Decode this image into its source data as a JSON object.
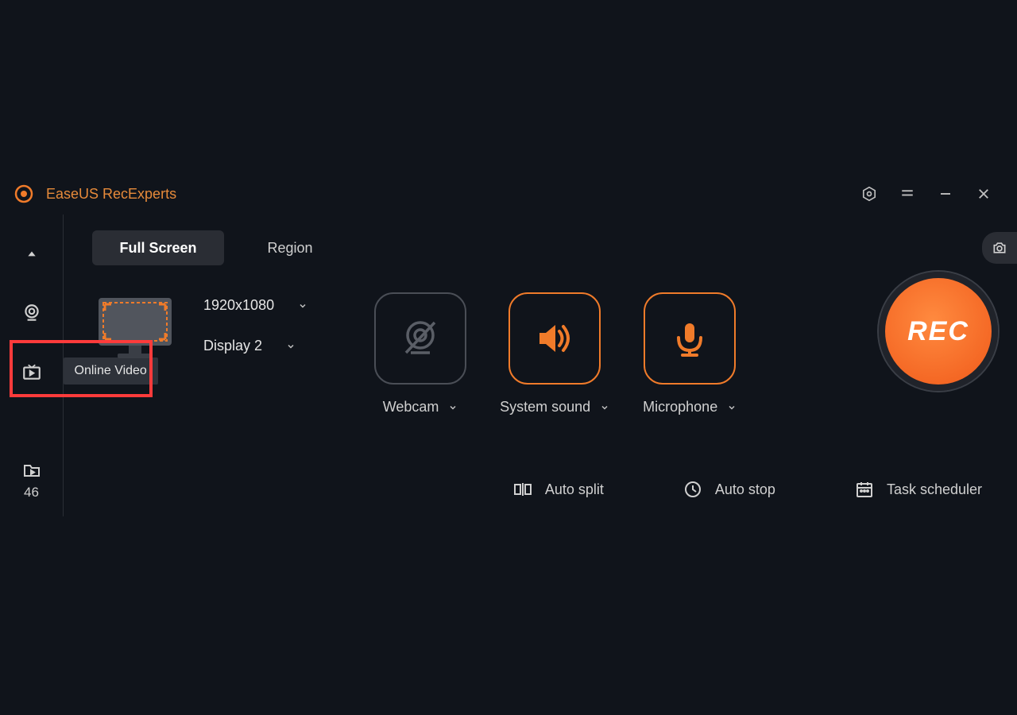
{
  "header": {
    "title": "EaseUS RecExperts"
  },
  "sidebar": {
    "tooltip": "Online Video",
    "files_count": "46"
  },
  "tabs": {
    "full_screen": "Full Screen",
    "region": "Region"
  },
  "resolution": {
    "value": "1920x1080",
    "display": "Display 2"
  },
  "sources": {
    "webcam": "Webcam",
    "system_sound": "System sound",
    "microphone": "Microphone"
  },
  "rec": {
    "label": "REC"
  },
  "footer": {
    "auto_split": "Auto split",
    "auto_stop": "Auto stop",
    "task_scheduler": "Task scheduler"
  }
}
